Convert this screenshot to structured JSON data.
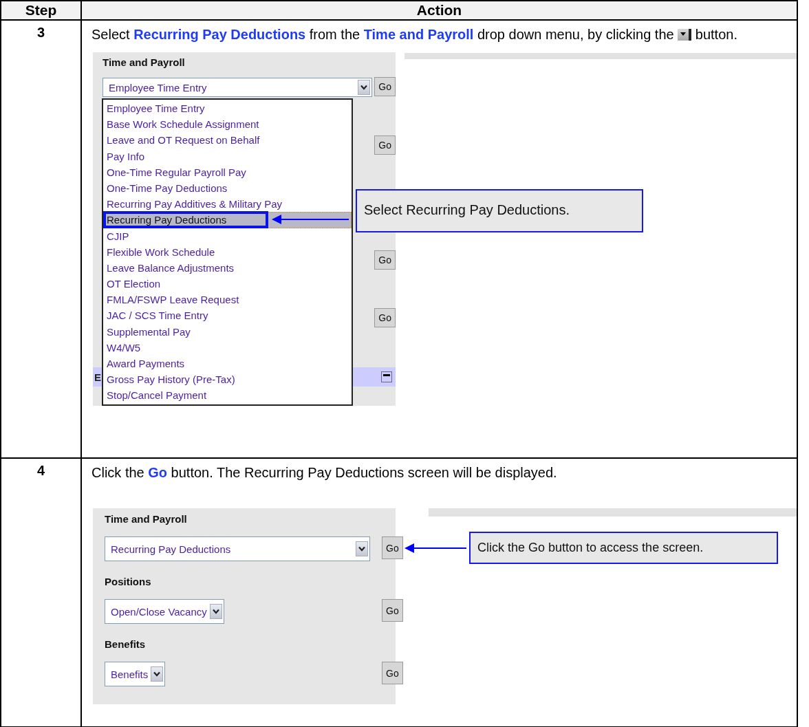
{
  "table": {
    "columns": [
      "Step",
      "Action"
    ],
    "rows": [
      {
        "step": "3",
        "instruction": "Select **Recurring Pay Deductions** from the **Time and Payroll** drop down menu, by clicking the",
        "instruction_end": "button.",
        "screenshot": {
          "kind": "open_dropdown",
          "section_label": "Time and Payroll",
          "select_value": "Employee Time Entry",
          "go_buttons": [
            "Go",
            "Go",
            "Go",
            "Go"
          ],
          "bar_text": "E",
          "options": [
            {
              "label": "Employee Time Entry",
              "selected": false
            },
            {
              "label": "Base Work Schedule Assignment",
              "selected": false
            },
            {
              "label": "Leave and OT Request on Behalf",
              "selected": false
            },
            {
              "label": "Pay Info",
              "selected": false
            },
            {
              "label": "One-Time Regular Payroll Pay",
              "selected": false
            },
            {
              "label": "One-Time Pay Deductions",
              "selected": false
            },
            {
              "label": "Recurring Pay Additives & Military Pay",
              "selected": false
            },
            {
              "label": "Recurring Pay Deductions",
              "selected": true
            },
            {
              "label": "CJIP",
              "selected": false
            },
            {
              "label": "Flexible Work Schedule",
              "selected": false
            },
            {
              "label": "Leave Balance Adjustments",
              "selected": false
            },
            {
              "label": "OT Election",
              "selected": false
            },
            {
              "label": "FMLA/FSWP Leave Request",
              "selected": false
            },
            {
              "label": "JAC / SCS Time Entry",
              "selected": false
            },
            {
              "label": "Supplemental Pay",
              "selected": false
            },
            {
              "label": "W4/W5",
              "selected": false
            },
            {
              "label": "Award Payments",
              "selected": false
            },
            {
              "label": "Gross Pay History (Pre-Tax)",
              "selected": false
            },
            {
              "label": "Stop/Cancel Payment",
              "selected": false
            }
          ],
          "callout": "Select Recurring Pay Deductions."
        }
      },
      {
        "step": "4",
        "instruction": "Click the **Go** button.  The Recurring Pay Deductions screen will be displayed.",
        "screenshot": {
          "kind": "form",
          "sections": [
            {
              "label": "Time and Payroll",
              "value": "Recurring Pay Deductions",
              "go": "Go"
            },
            {
              "label": "Positions",
              "value": "Open/Close Vacancy",
              "go": "Go"
            },
            {
              "label": "Benefits",
              "value": "Benefits",
              "go": "Go"
            }
          ],
          "callout": "Click the Go button to access the screen."
        }
      }
    ]
  }
}
